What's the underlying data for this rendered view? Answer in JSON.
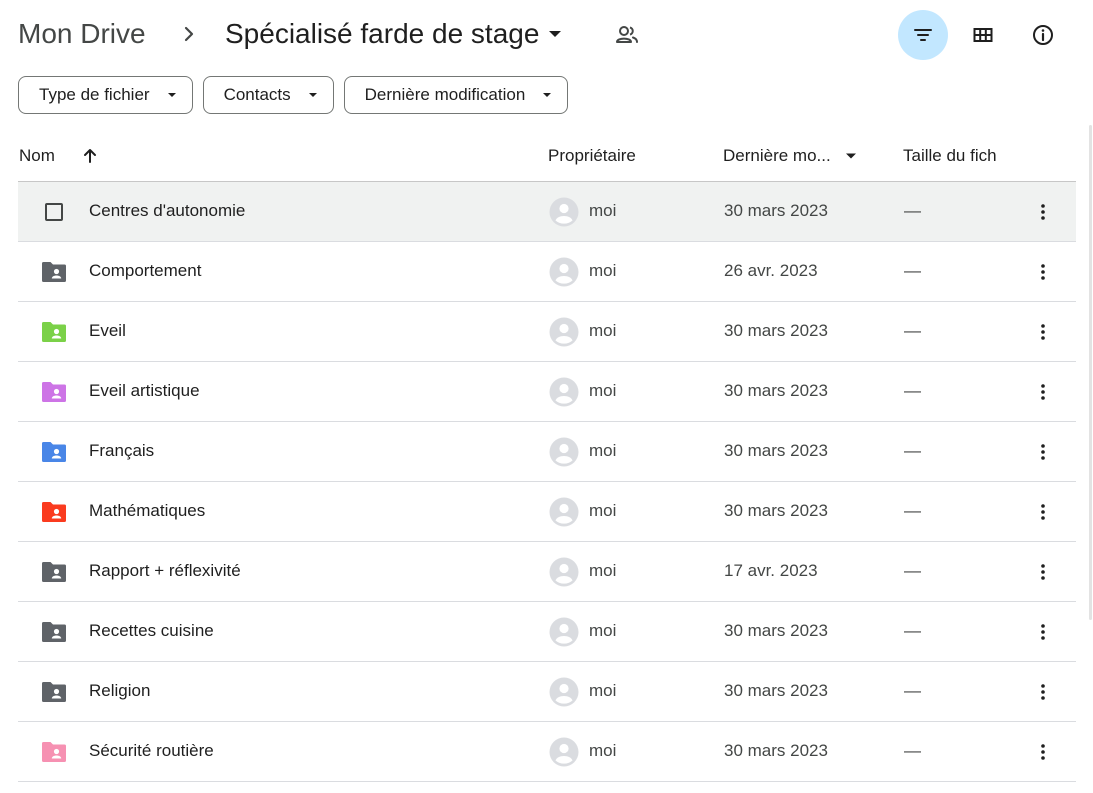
{
  "breadcrumb": {
    "root": "Mon Drive",
    "current": "Spécialisé farde de stage"
  },
  "filters": [
    {
      "label": "Type de fichier"
    },
    {
      "label": "Contacts"
    },
    {
      "label": "Dernière modification"
    }
  ],
  "columns": {
    "name": "Nom",
    "owner": "Propriétaire",
    "modified": "Dernière mo...",
    "size": "Taille du fich"
  },
  "files": [
    {
      "name": "Centres d'autonomie",
      "owner": "moi",
      "modified": "30 mars 2023",
      "size": "—",
      "color": "#5f6368",
      "selected_hover": true
    },
    {
      "name": "Comportement",
      "owner": "moi",
      "modified": "26 avr. 2023",
      "size": "—",
      "color": "#5f6368"
    },
    {
      "name": "Eveil",
      "owner": "moi",
      "modified": "30 mars 2023",
      "size": "—",
      "color": "#7bd148"
    },
    {
      "name": "Eveil artistique",
      "owner": "moi",
      "modified": "30 mars 2023",
      "size": "—",
      "color": "#cd74e6"
    },
    {
      "name": "Français",
      "owner": "moi",
      "modified": "30 mars 2023",
      "size": "—",
      "color": "#4986e7"
    },
    {
      "name": "Mathématiques",
      "owner": "moi",
      "modified": "30 mars 2023",
      "size": "—",
      "color": "#fa3b1f"
    },
    {
      "name": "Rapport + réflexivité",
      "owner": "moi",
      "modified": "17 avr. 2023",
      "size": "—",
      "color": "#5f6368"
    },
    {
      "name": "Recettes cuisine",
      "owner": "moi",
      "modified": "30 mars 2023",
      "size": "—",
      "color": "#5f6368"
    },
    {
      "name": "Religion",
      "owner": "moi",
      "modified": "30 mars 2023",
      "size": "—",
      "color": "#5f6368"
    },
    {
      "name": "Sécurité routière",
      "owner": "moi",
      "modified": "30 mars 2023",
      "size": "—",
      "color": "#f691b2"
    }
  ],
  "icons": {
    "breadcrumb_separator": "chevron-right-icon",
    "folder_menu": "caret-down-icon",
    "shared": "people-icon",
    "filter": "filter-icon",
    "grid_view": "grid-icon",
    "details": "info-icon",
    "sort": "arrow-up-icon",
    "more": "more-vert-icon",
    "avatar": "user-avatar-icon"
  },
  "colors": {
    "active_button": "#c2e7ff",
    "row_hover": "#f0f2f1"
  }
}
